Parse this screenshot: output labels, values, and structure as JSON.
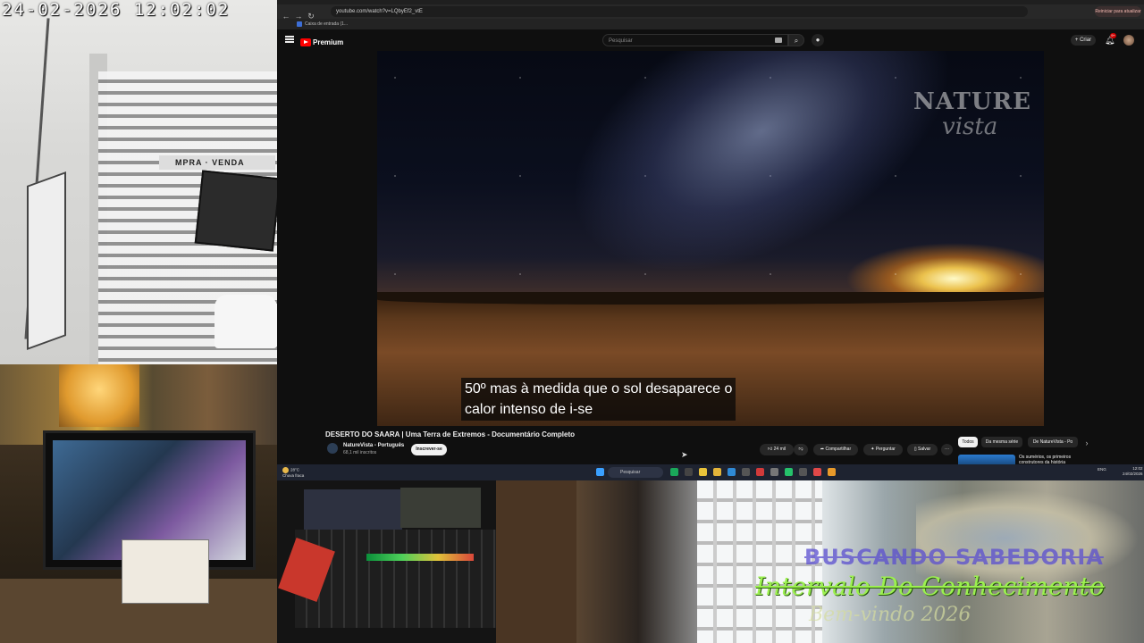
{
  "camera_street": {
    "timestamp": "24-02-2026 12:02:02",
    "sign_text": "MPRA · VENDA"
  },
  "overlay": {
    "line1": "BUSCANDO SABEDORIA",
    "line2": "Intervalo Do Conhecimento",
    "line3": "Bem-vindo 2026"
  },
  "browser": {
    "url": "youtube.com/watch?v=LQbyEf2_vtE",
    "relaunch": "Reiniciar para atualizar",
    "bookmark": "Caixa de entrada (1...",
    "colors": {
      "accent": "#ff0000",
      "background": "#0f0f0f"
    }
  },
  "youtube": {
    "logo_text": "Premium",
    "search_placeholder": "Pesquisar",
    "create_label": "Criar",
    "notifications_badge": "9+",
    "video": {
      "watermark_line1": "NATURE",
      "watermark_line2": "vista",
      "caption": "50º mas à medida que o sol desaparece o\ncalor intenso de i-se",
      "title": "DESERTO DO SAARA | Uma Terra de Extremos - Documentário Completo",
      "channel": "NatureVista - Português",
      "subscribers": "68,1 mil inscritos",
      "subscribe_label": "Inscrever-se",
      "likes": "24 mil",
      "share": "Compartilhar",
      "ask": "Perguntar",
      "save": "Salvar",
      "more": "···"
    },
    "chips": [
      "Todos",
      "Da mesma série",
      "De NatureVista - Po"
    ],
    "recommendation_title": "Os sumérios, os primeiros construtores da história"
  },
  "taskbar": {
    "weather_temp": "28°C",
    "weather_desc": "Chuva fraca",
    "search": "Pesquisar",
    "lang": "ENG",
    "time": "12:02",
    "date": "24/02/2026"
  }
}
